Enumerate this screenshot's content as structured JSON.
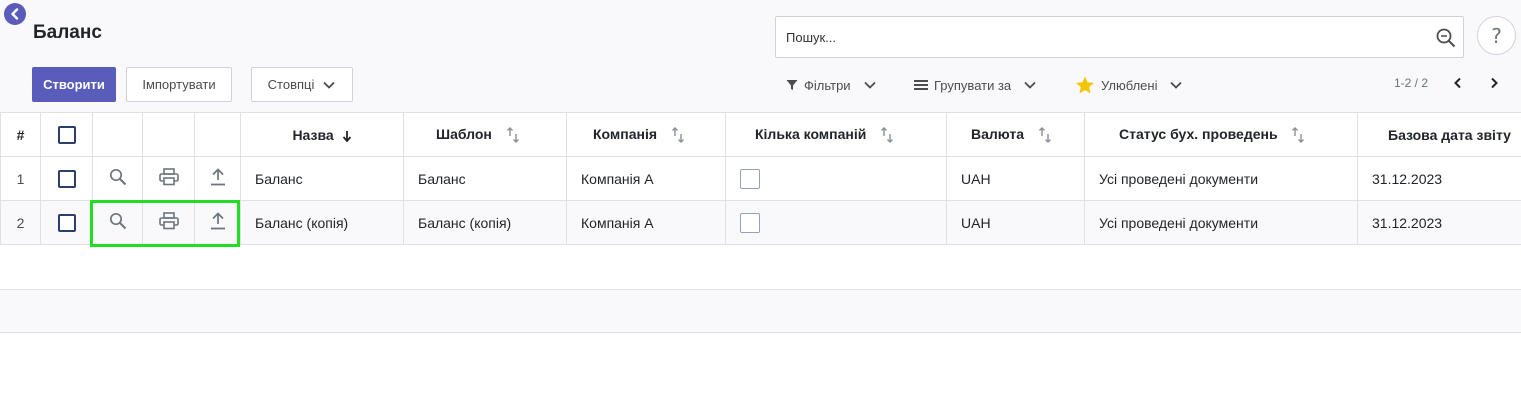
{
  "header": {
    "title": "Баланс",
    "create_label": "Створити",
    "import_label": "Імпортувати",
    "columns_label": "Стовпці"
  },
  "search": {
    "placeholder": "Пошук..."
  },
  "help_label": "?",
  "filters": {
    "filters_label": "Фільтри",
    "group_label": "Групувати за",
    "favorites_label": "Улюблені"
  },
  "pager": {
    "text": "1-2 / 2"
  },
  "table": {
    "columns": {
      "num": "#",
      "name": "Назва",
      "template": "Шаблон",
      "company": "Компанія",
      "multi_company": "Кілька компаній",
      "currency": "Валюта",
      "posting_status": "Статус бух. проведень",
      "base_date": "Базова дата звіту"
    },
    "rows": [
      {
        "num": "1",
        "name": "Баланс",
        "template": "Баланс",
        "company": "Компанія А",
        "currency": "UAH",
        "posting_status": "Усі проведені документи",
        "base_date": "31.12.2023"
      },
      {
        "num": "2",
        "name": "Баланс (копія)",
        "template": "Баланс (копія)",
        "company": "Компанія А",
        "currency": "UAH",
        "posting_status": "Усі проведені документи",
        "base_date": "31.12.2023"
      }
    ]
  },
  "colors": {
    "primary": "#5a5cbb",
    "highlight": "#22dd22",
    "star": "#f3c400"
  }
}
